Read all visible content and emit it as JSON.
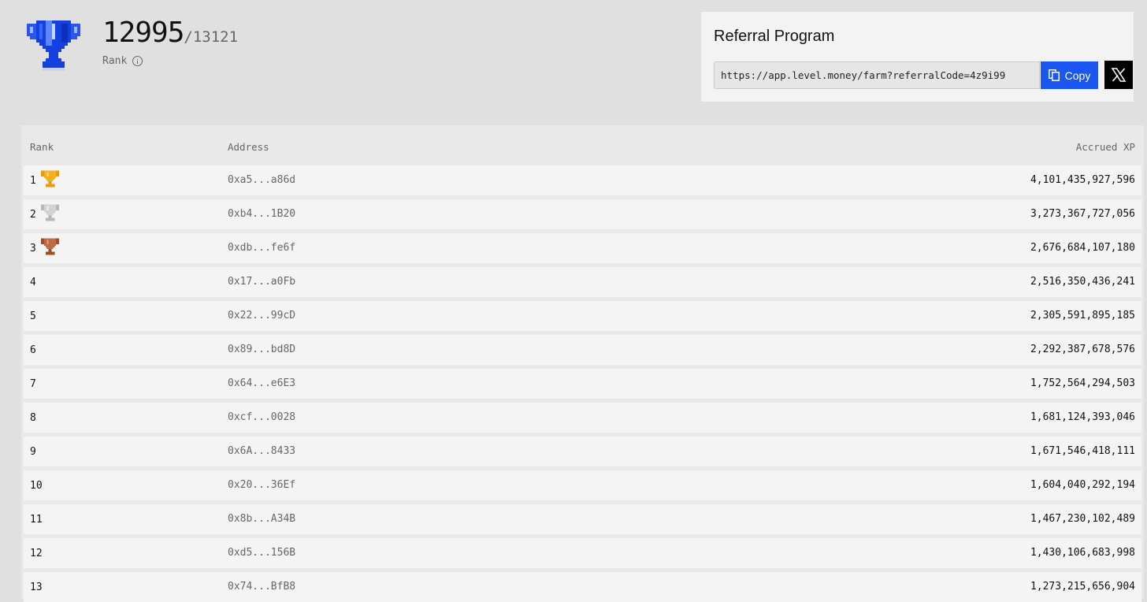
{
  "user": {
    "rank": "12995",
    "total": "/13121",
    "rank_label": "Rank"
  },
  "referral": {
    "title": "Referral Program",
    "link": "https://app.level.money/farm?referralCode=4z9i99",
    "copy_label": "Copy"
  },
  "colors": {
    "accent": "#1a56f0",
    "gold": "#f0a81c",
    "silver": "#c8c8c8",
    "bronze": "#b5623a"
  },
  "table": {
    "headers": {
      "rank": "Rank",
      "address": "Address",
      "xp": "Accrued XP"
    },
    "rows": [
      {
        "rank": "1",
        "address": "0xa5...a86d",
        "xp": "4,101,435,927,596",
        "medal": "gold-trophy-icon"
      },
      {
        "rank": "2",
        "address": "0xb4...1B20",
        "xp": "3,273,367,727,056",
        "medal": "silver-trophy-icon"
      },
      {
        "rank": "3",
        "address": "0xdb...fe6f",
        "xp": "2,676,684,107,180",
        "medal": "bronze-trophy-icon"
      },
      {
        "rank": "4",
        "address": "0x17...a0Fb",
        "xp": "2,516,350,436,241"
      },
      {
        "rank": "5",
        "address": "0x22...99cD",
        "xp": "2,305,591,895,185"
      },
      {
        "rank": "6",
        "address": "0x89...bd8D",
        "xp": "2,292,387,678,576"
      },
      {
        "rank": "7",
        "address": "0x64...e6E3",
        "xp": "1,752,564,294,503"
      },
      {
        "rank": "8",
        "address": "0xcf...0028",
        "xp": "1,681,124,393,046"
      },
      {
        "rank": "9",
        "address": "0x6A...8433",
        "xp": "1,671,546,418,111"
      },
      {
        "rank": "10",
        "address": "0x20...36Ef",
        "xp": "1,604,040,292,194"
      },
      {
        "rank": "11",
        "address": "0x8b...A34B",
        "xp": "1,467,230,102,489"
      },
      {
        "rank": "12",
        "address": "0xd5...156B",
        "xp": "1,430,106,683,998"
      },
      {
        "rank": "13",
        "address": "0x74...BfB8",
        "xp": "1,273,215,656,904"
      }
    ]
  }
}
